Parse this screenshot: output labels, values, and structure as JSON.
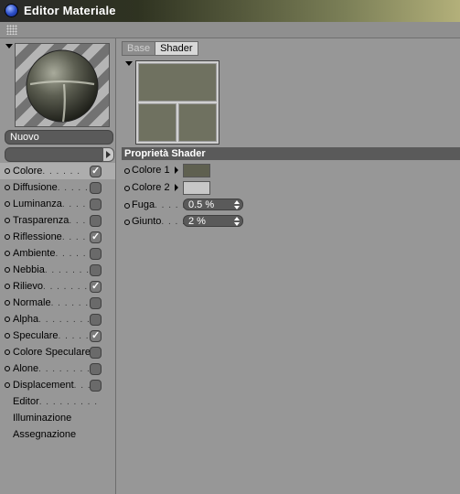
{
  "window": {
    "title": "Editor Materiale",
    "icon": "app-sphere-icon",
    "toolbar_icon": "grip-icon"
  },
  "material": {
    "name": "Nuovo",
    "preview": "material-sphere-preview"
  },
  "channels": [
    {
      "label": "Colore",
      "dots": ". . . . . .",
      "checked": true,
      "selected": true
    },
    {
      "label": "Diffusione",
      "dots": ". . . . . .",
      "checked": false
    },
    {
      "label": "Luminanza",
      "dots": ". . . . .",
      "checked": false
    },
    {
      "label": "Trasparenza",
      "dots": ". . . .",
      "checked": false
    },
    {
      "label": "Riflessione",
      "dots": ". . . . .",
      "checked": true
    },
    {
      "label": "Ambiente",
      "dots": ". . . . . .",
      "checked": false
    },
    {
      "label": "Nebbia",
      "dots": ". . . . . . .",
      "checked": false
    },
    {
      "label": "Rilievo",
      "dots": ". . . . . . . .",
      "checked": true
    },
    {
      "label": "Normale",
      "dots": ". . . . . .",
      "checked": false
    },
    {
      "label": "Alpha",
      "dots": ". . . . . . . .",
      "checked": false
    },
    {
      "label": "Speculare",
      "dots": ". . . . .",
      "checked": true
    },
    {
      "label": "Colore Speculare",
      "dots": "",
      "checked": false
    },
    {
      "label": "Alone",
      "dots": ". . . . . . . .",
      "checked": false
    },
    {
      "label": "Displacement",
      "dots": ". . .",
      "checked": false
    }
  ],
  "extra_items": [
    {
      "label": "Editor",
      "dots": ". . . . . . . . ."
    },
    {
      "label": "Illuminazione",
      "dots": ""
    },
    {
      "label": "Assegnazione",
      "dots": ""
    }
  ],
  "tabs": [
    {
      "label": "Base",
      "active": false
    },
    {
      "label": "Shader",
      "active": true
    }
  ],
  "shader": {
    "section_title": "Proprietà Shader",
    "props": [
      {
        "label": "Colore 1",
        "type": "color",
        "color": "#5f6050"
      },
      {
        "label": "Colore 2",
        "type": "color",
        "color": "#c7c7c7"
      },
      {
        "label": "Fuga",
        "dots": ". . . . .",
        "type": "number",
        "value": "0.5 %"
      },
      {
        "label": "Giunto",
        "dots": ". . . .",
        "type": "number",
        "value": "2 %"
      }
    ]
  },
  "colors": {
    "panel": "#979797",
    "field": "#5a5a5a",
    "tile": "#6f7160"
  }
}
